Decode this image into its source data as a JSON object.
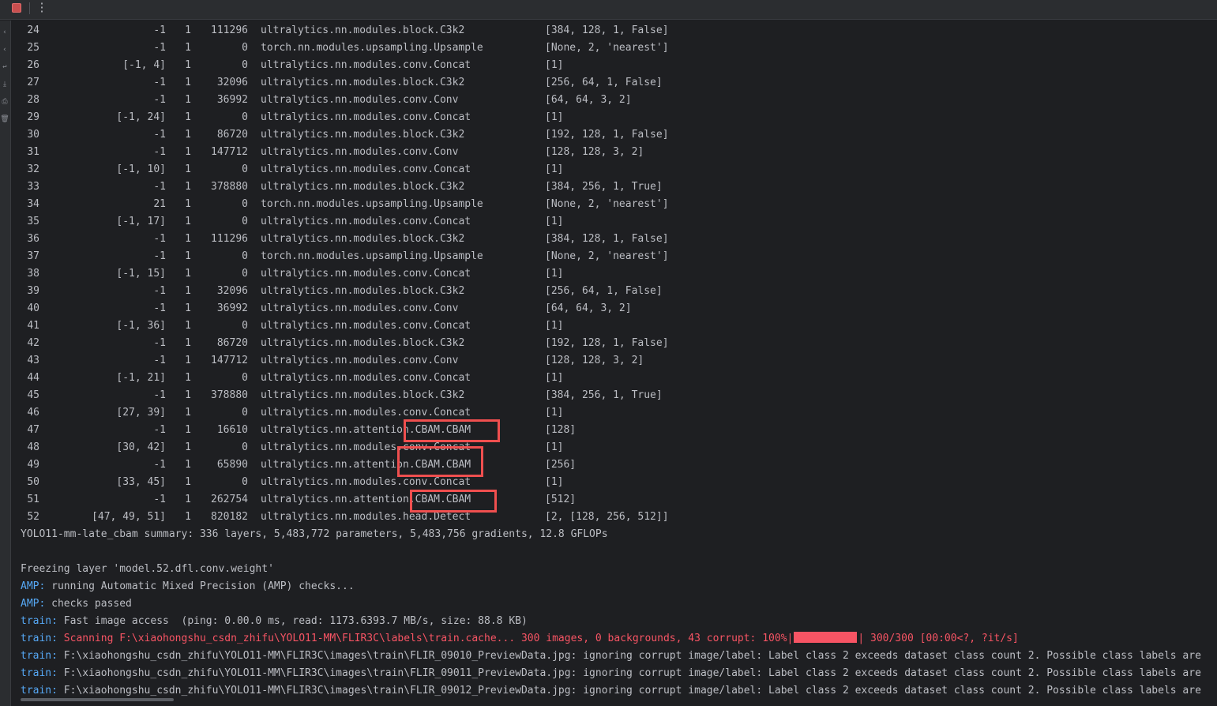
{
  "toolbar": {
    "stop_icon": "stop-icon",
    "more_icon": "more-vertical-icon",
    "more_glyph": "⋮"
  },
  "gutter": {
    "icons": [
      {
        "name": "scroll-up-icon",
        "glyph": "‹"
      },
      {
        "name": "scroll-down-icon",
        "glyph": "‹"
      },
      {
        "name": "soft-wrap-icon",
        "glyph": "↩"
      },
      {
        "name": "scroll-to-end-icon",
        "glyph": "⤓"
      },
      {
        "name": "print-icon",
        "glyph": "⎙"
      },
      {
        "name": "clear-all-icon",
        "glyph": "🗑"
      }
    ]
  },
  "layers": [
    {
      "idx": "24",
      "from": "-1",
      "n": "1",
      "params": "111296",
      "module": "ultralytics.nn.modules.block.C3k2",
      "args": "[384, 128, 1, False]"
    },
    {
      "idx": "25",
      "from": "-1",
      "n": "1",
      "params": "0",
      "module": "torch.nn.modules.upsampling.Upsample",
      "args": "[None, 2, 'nearest']"
    },
    {
      "idx": "26",
      "from": "[-1, 4]",
      "n": "1",
      "params": "0",
      "module": "ultralytics.nn.modules.conv.Concat",
      "args": "[1]"
    },
    {
      "idx": "27",
      "from": "-1",
      "n": "1",
      "params": "32096",
      "module": "ultralytics.nn.modules.block.C3k2",
      "args": "[256, 64, 1, False]"
    },
    {
      "idx": "28",
      "from": "-1",
      "n": "1",
      "params": "36992",
      "module": "ultralytics.nn.modules.conv.Conv",
      "args": "[64, 64, 3, 2]"
    },
    {
      "idx": "29",
      "from": "[-1, 24]",
      "n": "1",
      "params": "0",
      "module": "ultralytics.nn.modules.conv.Concat",
      "args": "[1]"
    },
    {
      "idx": "30",
      "from": "-1",
      "n": "1",
      "params": "86720",
      "module": "ultralytics.nn.modules.block.C3k2",
      "args": "[192, 128, 1, False]"
    },
    {
      "idx": "31",
      "from": "-1",
      "n": "1",
      "params": "147712",
      "module": "ultralytics.nn.modules.conv.Conv",
      "args": "[128, 128, 3, 2]"
    },
    {
      "idx": "32",
      "from": "[-1, 10]",
      "n": "1",
      "params": "0",
      "module": "ultralytics.nn.modules.conv.Concat",
      "args": "[1]"
    },
    {
      "idx": "33",
      "from": "-1",
      "n": "1",
      "params": "378880",
      "module": "ultralytics.nn.modules.block.C3k2",
      "args": "[384, 256, 1, True]"
    },
    {
      "idx": "34",
      "from": "21",
      "n": "1",
      "params": "0",
      "module": "torch.nn.modules.upsampling.Upsample",
      "args": "[None, 2, 'nearest']"
    },
    {
      "idx": "35",
      "from": "[-1, 17]",
      "n": "1",
      "params": "0",
      "module": "ultralytics.nn.modules.conv.Concat",
      "args": "[1]"
    },
    {
      "idx": "36",
      "from": "-1",
      "n": "1",
      "params": "111296",
      "module": "ultralytics.nn.modules.block.C3k2",
      "args": "[384, 128, 1, False]"
    },
    {
      "idx": "37",
      "from": "-1",
      "n": "1",
      "params": "0",
      "module": "torch.nn.modules.upsampling.Upsample",
      "args": "[None, 2, 'nearest']"
    },
    {
      "idx": "38",
      "from": "[-1, 15]",
      "n": "1",
      "params": "0",
      "module": "ultralytics.nn.modules.conv.Concat",
      "args": "[1]"
    },
    {
      "idx": "39",
      "from": "-1",
      "n": "1",
      "params": "32096",
      "module": "ultralytics.nn.modules.block.C3k2",
      "args": "[256, 64, 1, False]"
    },
    {
      "idx": "40",
      "from": "-1",
      "n": "1",
      "params": "36992",
      "module": "ultralytics.nn.modules.conv.Conv",
      "args": "[64, 64, 3, 2]"
    },
    {
      "idx": "41",
      "from": "[-1, 36]",
      "n": "1",
      "params": "0",
      "module": "ultralytics.nn.modules.conv.Concat",
      "args": "[1]"
    },
    {
      "idx": "42",
      "from": "-1",
      "n": "1",
      "params": "86720",
      "module": "ultralytics.nn.modules.block.C3k2",
      "args": "[192, 128, 1, False]"
    },
    {
      "idx": "43",
      "from": "-1",
      "n": "1",
      "params": "147712",
      "module": "ultralytics.nn.modules.conv.Conv",
      "args": "[128, 128, 3, 2]"
    },
    {
      "idx": "44",
      "from": "[-1, 21]",
      "n": "1",
      "params": "0",
      "module": "ultralytics.nn.modules.conv.Concat",
      "args": "[1]"
    },
    {
      "idx": "45",
      "from": "-1",
      "n": "1",
      "params": "378880",
      "module": "ultralytics.nn.modules.block.C3k2",
      "args": "[384, 256, 1, True]"
    },
    {
      "idx": "46",
      "from": "[27, 39]",
      "n": "1",
      "params": "0",
      "module": "ultralytics.nn.modules.conv.Concat",
      "args": "[1]"
    },
    {
      "idx": "47",
      "from": "-1",
      "n": "1",
      "params": "16610",
      "module": "ultralytics.nn.attention.CBAM.CBAM",
      "args": "[128]"
    },
    {
      "idx": "48",
      "from": "[30, 42]",
      "n": "1",
      "params": "0",
      "module": "ultralytics.nn.modules.conv.Concat",
      "args": "[1]"
    },
    {
      "idx": "49",
      "from": "-1",
      "n": "1",
      "params": "65890",
      "module": "ultralytics.nn.attention.CBAM.CBAM",
      "args": "[256]"
    },
    {
      "idx": "50",
      "from": "[33, 45]",
      "n": "1",
      "params": "0",
      "module": "ultralytics.nn.modules.conv.Concat",
      "args": "[1]"
    },
    {
      "idx": "51",
      "from": "-1",
      "n": "1",
      "params": "262754",
      "module": "ultralytics.nn.attention.CBAM.CBAM",
      "args": "[512]"
    },
    {
      "idx": "52",
      "from": "[47, 49, 51]",
      "n": "1",
      "params": "820182",
      "module": "ultralytics.nn.modules.head.Detect",
      "args": "[2, [128, 256, 512]]"
    }
  ],
  "summary": "YOLO11-mm-late_cbam summary: 336 layers, 5,483,772 parameters, 5,483,756 gradients, 12.8 GFLOPs",
  "freezing": "Freezing layer 'model.52.dfl.conv.weight'",
  "amp": [
    {
      "tag": "AMP:",
      "text": " running Automatic Mixed Precision (AMP) checks..."
    },
    {
      "tag": "AMP:",
      "text": " checks passed"
    }
  ],
  "train_access": {
    "tag": "train:",
    "text": " Fast image access  (ping: 0.00.0 ms, read: 1173.6393.7 MB/s, size: 88.8 KB)"
  },
  "train_scan": {
    "tag": "train:",
    "text": " Scanning F:\\xiaohongshu_csdn_zhifu\\YOLO11-MM\\FLIR3C\\labels\\train.cache... 300 images, 0 backgrounds, 43 corrupt: 100%|",
    "progress_fraction": 1.0,
    "tail": "| 300/300 [00:00<?, ?it/s]"
  },
  "train_warnings": [
    {
      "tag": "train:",
      "text": " F:\\xiaohongshu_csdn_zhifu\\YOLO11-MM\\FLIR3C\\images\\train\\FLIR_09010_PreviewData.jpg: ignoring corrupt image/label: Label class 2 exceeds dataset class count 2. Possible class labels are"
    },
    {
      "tag": "train:",
      "text": " F:\\xiaohongshu_csdn_zhifu\\YOLO11-MM\\FLIR3C\\images\\train\\FLIR_09011_PreviewData.jpg: ignoring corrupt image/label: Label class 2 exceeds dataset class count 2. Possible class labels are"
    },
    {
      "tag": "train:",
      "text": " F:\\xiaohongshu_csdn_zhifu\\YOLO11-MM\\FLIR3C\\images\\train\\FLIR_09012_PreviewData.jpg: ignoring corrupt image/label: Label class 2 exceeds dataset class count 2. Possible class labels are"
    }
  ],
  "colors": {
    "background": "#1e1f22",
    "text": "#bcbec4",
    "keyword": "#56a8f5",
    "error": "#f75464",
    "highlight_box": "#ef4f4f"
  }
}
